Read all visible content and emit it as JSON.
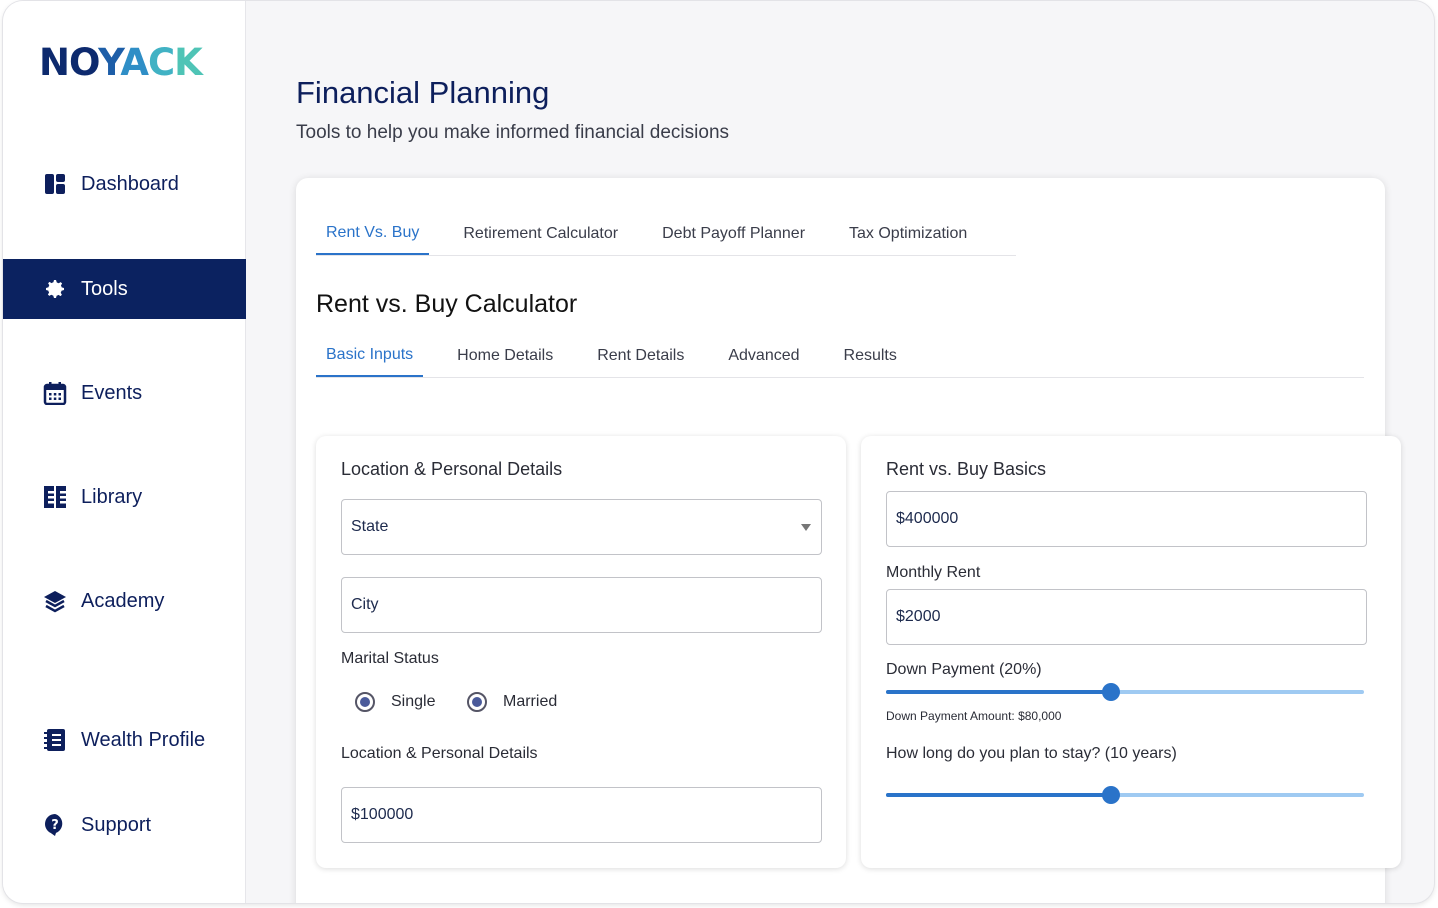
{
  "brand": {
    "logo": "NOYACK"
  },
  "sidebar": {
    "items": [
      {
        "label": "Dashboard",
        "icon": "dashboard-icon",
        "active": false
      },
      {
        "label": "Tools",
        "icon": "gear-icon",
        "active": true
      },
      {
        "label": "Events",
        "icon": "calendar-icon",
        "active": false
      },
      {
        "label": "Library",
        "icon": "library-icon",
        "active": false
      },
      {
        "label": "Academy",
        "icon": "academy-icon",
        "active": false
      },
      {
        "label": "Wealth Profile",
        "icon": "notebook-icon",
        "active": false
      },
      {
        "label": "Support",
        "icon": "help-icon",
        "active": false
      }
    ]
  },
  "header": {
    "title": "Financial Planning",
    "subtitle": "Tools to help you make informed financial decisions"
  },
  "tool_tabs": [
    "Rent Vs. Buy",
    "Retirement Calculator",
    "Debt Payoff Planner",
    "Tax Optimization"
  ],
  "calculator": {
    "title": "Rent vs. Buy Calculator",
    "tabs": [
      "Basic Inputs",
      "Home Details",
      "Rent Details",
      "Advanced",
      "Results"
    ]
  },
  "location_panel": {
    "title": "Location & Personal Details",
    "state_placeholder": "State",
    "city_placeholder": "City",
    "marital_label": "Marital Status",
    "radio_single": "Single",
    "radio_married": "Married",
    "income_label": "Location & Personal Details",
    "income_value": "$100000"
  },
  "basics_panel": {
    "title": "Rent vs. Buy Basics",
    "home_price_value": "$400000",
    "monthly_rent_label": "Monthly Rent",
    "monthly_rent_value": "$2000",
    "down_payment_label": "Down Payment (20%)",
    "down_payment_level": 0.47,
    "down_payment_amount": "Down Payment Amount: $80,000",
    "stay_label": "How long do you plan to stay? (10 years)",
    "stay_level": 0.47
  },
  "colors": {
    "accent": "#2a73c9",
    "nav_active": "#0b2260",
    "brand_dark": "#0d2a6e"
  }
}
